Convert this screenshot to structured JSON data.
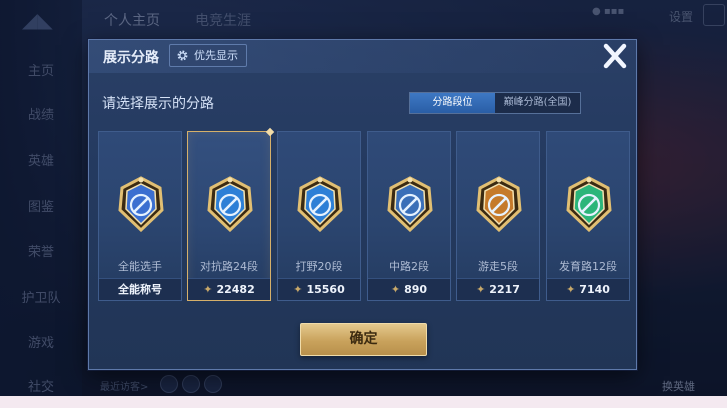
{
  "background": {
    "nav_items": [
      "主页",
      "战绩",
      "英雄",
      "图鉴",
      "荣誉",
      "护卫队",
      "游戏",
      "社交"
    ],
    "top_tabs": [
      "个人主页",
      "电竞生涯"
    ],
    "settings_label": "设置",
    "bottom_hint": "最近访客>",
    "right_label": "换英雄"
  },
  "dialog": {
    "title": "展示分路",
    "priority_label": "优先显示",
    "prompt": "请选择展示的分路",
    "tabs": [
      {
        "label": "分路段位",
        "active": true
      },
      {
        "label": "巅峰分路(全国)",
        "active": false
      }
    ],
    "cards": [
      {
        "name": "全能选手",
        "footer": "全能称号",
        "has_points": false,
        "selected": false,
        "emblem": "all-round-emblem-icon",
        "color": "#3b6fd0"
      },
      {
        "name": "对抗路24段",
        "footer": "22482",
        "has_points": true,
        "selected": true,
        "emblem": "clash-lane-emblem-icon",
        "color": "#2d7fd6"
      },
      {
        "name": "打野20段",
        "footer": "15560",
        "has_points": true,
        "selected": false,
        "emblem": "jungle-emblem-icon",
        "color": "#2d7fd6"
      },
      {
        "name": "中路2段",
        "footer": "890",
        "has_points": true,
        "selected": false,
        "emblem": "mid-lane-emblem-icon",
        "color": "#3a6fb8"
      },
      {
        "name": "游走5段",
        "footer": "2217",
        "has_points": true,
        "selected": false,
        "emblem": "roam-emblem-icon",
        "color": "#c57a2a"
      },
      {
        "name": "发育路12段",
        "footer": "7140",
        "has_points": true,
        "selected": false,
        "emblem": "farm-lane-emblem-icon",
        "color": "#2bb57a"
      }
    ],
    "confirm_label": "确定"
  },
  "colors": {
    "accent_gold": "#d6b06a",
    "tab_active": "#3e78c4",
    "dialog_bg": "#263c63"
  }
}
